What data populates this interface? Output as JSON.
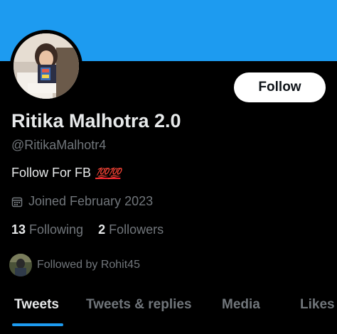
{
  "profile": {
    "name": "Ritika Malhotra 2.0",
    "handle": "@RitikaMalhotr4",
    "bio_text": "Follow For FB",
    "bio_emoji": "💯💯",
    "joined": "Joined February 2023",
    "following_count": "13",
    "following_label": "Following",
    "followers_count": "2",
    "followers_label": "Followers",
    "followed_by": "Followed by Rohit45"
  },
  "actions": {
    "follow_label": "Follow"
  },
  "tabs": [
    {
      "label": "Tweets",
      "active": true
    },
    {
      "label": "Tweets & replies",
      "active": false
    },
    {
      "label": "Media",
      "active": false
    },
    {
      "label": "Likes",
      "active": false
    }
  ],
  "colors": {
    "banner": "#1d9bf0",
    "background": "#000000",
    "primary_text": "#e7e9ea",
    "secondary_text": "#71767b",
    "accent": "#1d9bf0",
    "emoji_red": "#f4212e"
  },
  "icons": {
    "joined": "calendar-icon"
  }
}
